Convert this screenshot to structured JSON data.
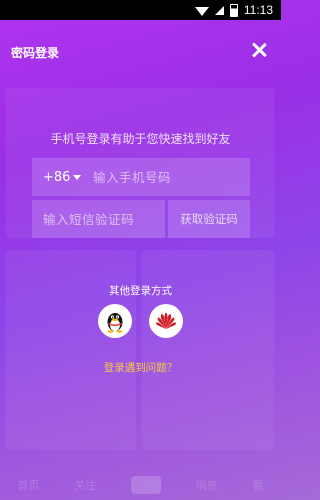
{
  "status_bar": {
    "time": "11:13"
  },
  "header": {
    "title": "密码登录"
  },
  "hint": "手机号登录有助于您快速找到好友",
  "phone": {
    "country_code": "+86",
    "placeholder": "输入手机号码"
  },
  "verification": {
    "placeholder": "输入短信验证码",
    "get_code_label": "获取验证码"
  },
  "other_login": {
    "title": "其他登录方式",
    "methods": [
      {
        "name": "QQ",
        "icon": "qq-penguin-icon"
      },
      {
        "name": "Huawei",
        "icon": "huawei-logo-icon"
      }
    ]
  },
  "trouble_link": "登录遇到问题？",
  "background_nav": {
    "items": [
      "首页",
      "关注",
      "消息",
      "我"
    ]
  },
  "colors": {
    "accent_yellow": "#f5c842",
    "gradient_top": "#b233f0",
    "gradient_bottom": "#a66ad8",
    "huawei_red": "#cf1d26"
  }
}
